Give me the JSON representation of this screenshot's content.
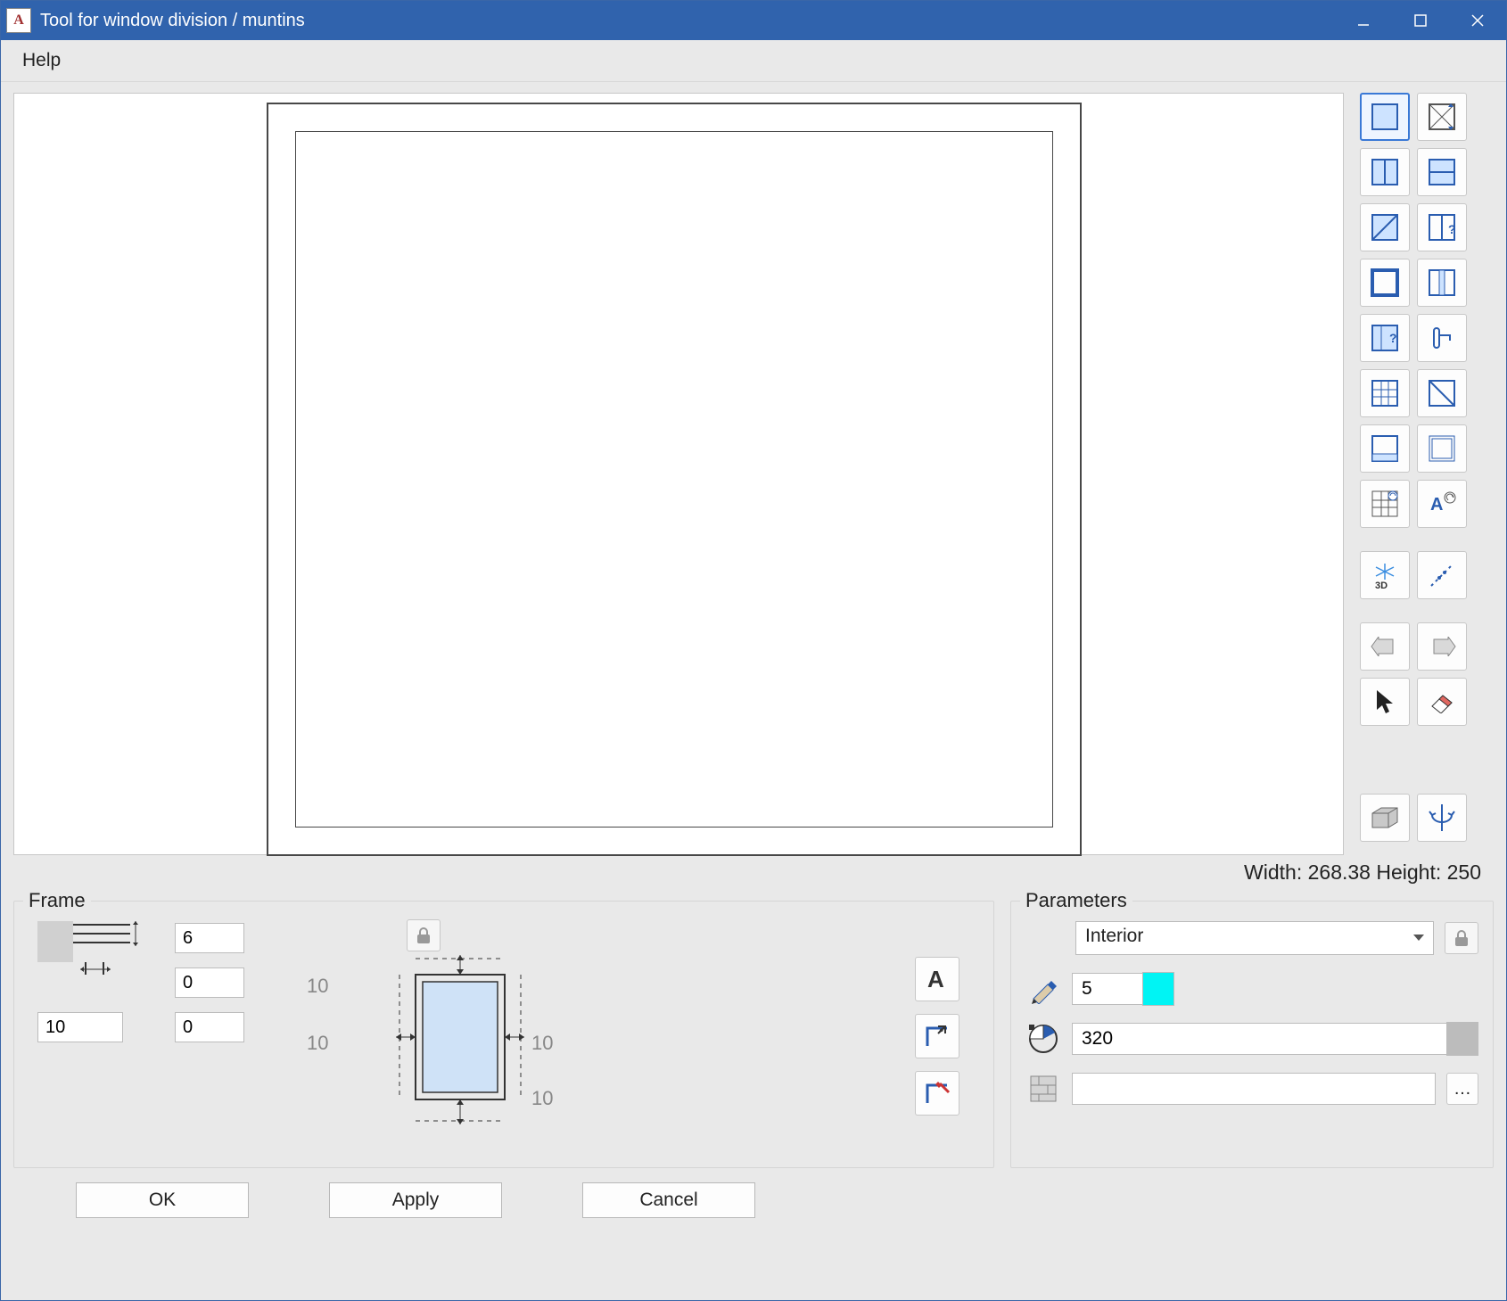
{
  "window": {
    "title": "Tool for window division / muntins"
  },
  "menu": {
    "help": "Help"
  },
  "status": {
    "width_label": "Width:",
    "width_value": "268.38",
    "height_label": "Height:",
    "height_value": "250"
  },
  "frame": {
    "title": "Frame",
    "val_top": "6",
    "val_mid": "0",
    "val_bottom": "0",
    "val_left": "10",
    "margin_top": "10",
    "margin_left": "10",
    "margin_right": "10",
    "margin_bottom": "10"
  },
  "parameters": {
    "title": "Parameters",
    "select_value": "Interior",
    "thickness": "5",
    "angle": "320",
    "texture": ""
  },
  "footer": {
    "ok": "OK",
    "apply": "Apply",
    "cancel": "Cancel"
  },
  "colors": {
    "swatch_thickness": "#00f4f4",
    "swatch_angle": "#bcbcbc"
  }
}
